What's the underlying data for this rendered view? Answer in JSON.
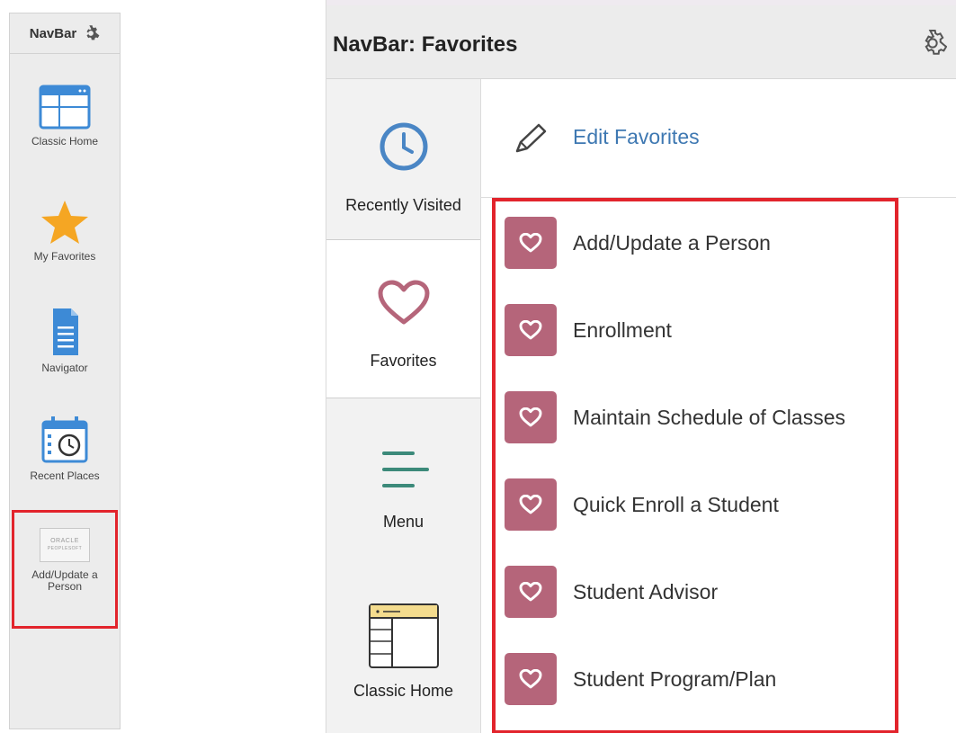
{
  "mini_nav": {
    "title": "NavBar",
    "items": [
      {
        "label": "Classic Home",
        "icon": "classic-home-icon"
      },
      {
        "label": "My Favorites",
        "icon": "star-icon"
      },
      {
        "label": "Navigator",
        "icon": "document-icon"
      },
      {
        "label": "Recent Places",
        "icon": "calendar-clock-icon"
      },
      {
        "label": "Add/Update a\nPerson",
        "icon": "oracle-peoplesoft-logo",
        "logo_lines": [
          "ORACLE",
          "PEOPLESOFT"
        ]
      }
    ]
  },
  "panel": {
    "title": "NavBar: Favorites",
    "tabs": [
      {
        "label": "Recently Visited",
        "icon": "clock-icon"
      },
      {
        "label": "Favorites",
        "icon": "heart-icon"
      },
      {
        "label": "Menu",
        "icon": "menu-icon"
      },
      {
        "label": "Classic Home",
        "icon": "classic-home-icon"
      }
    ],
    "edit_label": "Edit Favorites",
    "favorites": [
      {
        "label": "Add/Update a Person"
      },
      {
        "label": "Enrollment"
      },
      {
        "label": "Maintain Schedule of Classes"
      },
      {
        "label": "Quick Enroll a Student"
      },
      {
        "label": "Student Advisor"
      },
      {
        "label": "Student Program/Plan"
      }
    ]
  },
  "colors": {
    "favorite_badge": "#b5657a",
    "highlight": "#e2242c",
    "link": "#3e78b2",
    "clock_blue": "#4a86c5",
    "star_orange": "#f5a623",
    "menu_teal": "#3c8a7a"
  }
}
